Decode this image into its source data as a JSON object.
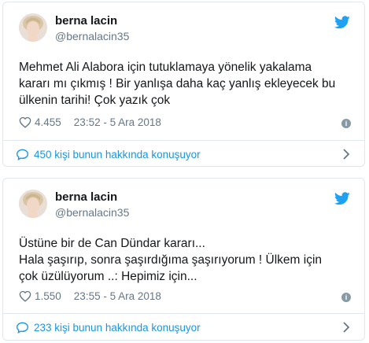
{
  "tweets": [
    {
      "name": "berna lacin",
      "handle": "@bernalacin35",
      "text_lines": [
        "Mehmet Ali Alabora için tutuklamaya yönelik yakalama",
        "kararı mı çıkmış ! Bir yanlışa daha kaç yanlış ekleyecek bu",
        "ülkenin tarihi! Çok yazık çok"
      ],
      "likes": "4.455",
      "timestamp": "23:52 - 5 Ara 2018",
      "conversation_label": "450 kişi bunun hakkında konuşuyor"
    },
    {
      "name": "berna lacin",
      "handle": "@bernalacin35",
      "text_lines": [
        "Üstüne bir de Can Dündar kararı...",
        "Hala şaşırıp, sonra şaşırdığıma şaşırıyorum ! Ülkem için",
        "çok üzülüyorum ..: Hepimiz için..."
      ],
      "likes": "1.550",
      "timestamp": "23:55 - 5 Ara 2018",
      "conversation_label": "233 kişi bunun hakkında konuşuyor"
    }
  ],
  "icons": {
    "brand": "twitter-bird-icon",
    "like": "heart-icon",
    "info": "info-icon",
    "reply": "speech-bubble-icon",
    "more": "chevron-right-icon"
  },
  "colors": {
    "twitter_blue": "#1da1f2",
    "link_blue": "#1b95e0",
    "secondary_text": "#657786",
    "border": "#e1e8ed"
  }
}
